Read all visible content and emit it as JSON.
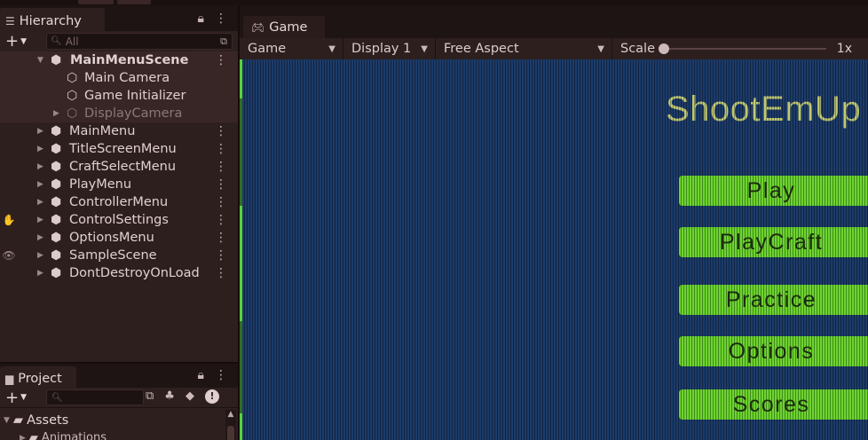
{
  "hierarchy": {
    "tab_label": "Hierarchy",
    "search_placeholder": "All",
    "items": [
      {
        "label": "MainMenuScene",
        "level": 0,
        "scene": true
      },
      {
        "label": "Main Camera",
        "level": 1
      },
      {
        "label": "Game Initializer",
        "level": 1
      },
      {
        "label": "DisplayCamera",
        "level": 1,
        "disabled": true
      },
      {
        "label": "MainMenu",
        "level": 0
      },
      {
        "label": "TitleScreenMenu",
        "level": 0
      },
      {
        "label": "CraftSelectMenu",
        "level": 0
      },
      {
        "label": "PlayMenu",
        "level": 0
      },
      {
        "label": "ControllerMenu",
        "level": 0
      },
      {
        "label": "ControlSettings",
        "level": 0
      },
      {
        "label": "OptionsMenu",
        "level": 0
      },
      {
        "label": "SampleScene",
        "level": 0
      },
      {
        "label": "DontDestroyOnLoad",
        "level": 0
      }
    ]
  },
  "project": {
    "tab_label": "Project",
    "root_folder": "Assets",
    "child_folder": "Animations"
  },
  "game": {
    "tab_label": "Game",
    "view_mode": "Game",
    "display": "Display 1",
    "aspect": "Free Aspect",
    "scale_label": "Scale",
    "scale_value": "1x",
    "scale_slider_fraction": 0,
    "screen": {
      "title": "ShootEmUp",
      "buttons": [
        "Play",
        "PlayCraft",
        "Practice",
        "Options",
        "Scores"
      ]
    }
  },
  "colors": {
    "editor_bg": "#2e1f1f",
    "game_button_green": "#6fd42f",
    "game_bg_blue": "#1c3c6a",
    "title_color": "#c3c873"
  }
}
